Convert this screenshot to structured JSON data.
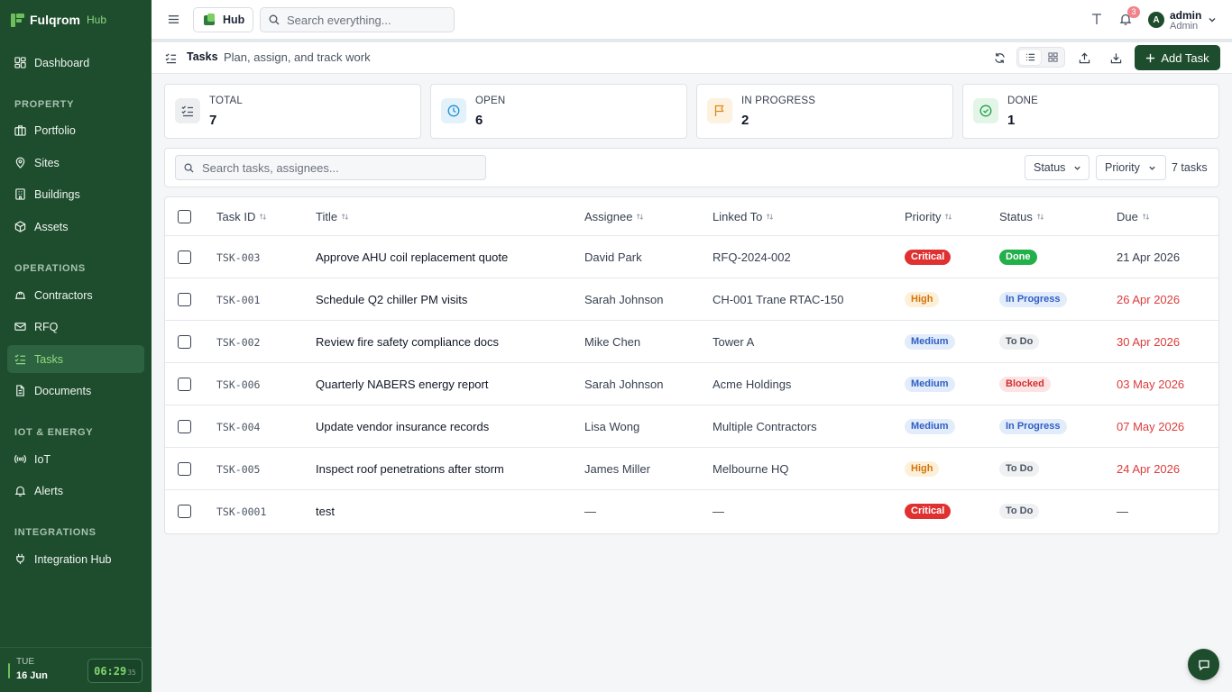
{
  "brand": {
    "name": "Fulqrom",
    "suffix": "Hub"
  },
  "sidebar": {
    "top_item": {
      "label": "Dashboard",
      "icon": "dashboard-icon"
    },
    "sections": [
      {
        "heading": "PROPERTY",
        "items": [
          {
            "label": "Portfolio",
            "icon": "briefcase-icon"
          },
          {
            "label": "Sites",
            "icon": "map-pin-icon"
          },
          {
            "label": "Buildings",
            "icon": "building-icon"
          },
          {
            "label": "Assets",
            "icon": "cube-icon"
          }
        ]
      },
      {
        "heading": "OPERATIONS",
        "items": [
          {
            "label": "Contractors",
            "icon": "hard-hat-icon"
          },
          {
            "label": "RFQ",
            "icon": "envelope-icon"
          },
          {
            "label": "Tasks",
            "icon": "list-checks-icon",
            "active": true
          },
          {
            "label": "Documents",
            "icon": "document-icon"
          }
        ]
      },
      {
        "heading": "IOT & ENERGY",
        "items": [
          {
            "label": "IoT",
            "icon": "radio-icon"
          },
          {
            "label": "Alerts",
            "icon": "bell-icon"
          }
        ]
      },
      {
        "heading": "INTEGRATIONS",
        "items": [
          {
            "label": "Integration Hub",
            "icon": "plug-icon"
          }
        ]
      }
    ],
    "footer": {
      "day": "TUE",
      "date": "16 Jun",
      "time": "06:29",
      "seconds": "35"
    }
  },
  "topbar": {
    "hub_label": "Hub",
    "search_placeholder": "Search everything...",
    "notification_count": "3",
    "user": {
      "initial": "A",
      "name": "admin",
      "role": "Admin"
    }
  },
  "page": {
    "title": "Tasks",
    "subtitle": "Plan, assign, and track work",
    "add_button": "Add Task"
  },
  "stats": [
    {
      "label": "TOTAL",
      "value": "7",
      "icon": "list-checks-icon",
      "color": "#4b5563",
      "bg": "#eceef0"
    },
    {
      "label": "OPEN",
      "value": "6",
      "icon": "clock-icon",
      "color": "#1f8fd8",
      "bg": "#e3f1fb"
    },
    {
      "label": "IN PROGRESS",
      "value": "2",
      "icon": "flag-icon",
      "color": "#e08a13",
      "bg": "#fdf1df"
    },
    {
      "label": "DONE",
      "value": "1",
      "icon": "check-circle-icon",
      "color": "#22a04a",
      "bg": "#e2f5e7"
    }
  ],
  "filters": {
    "search_placeholder": "Search tasks, assignees...",
    "status_label": "Status",
    "priority_label": "Priority",
    "count_text": "7 tasks"
  },
  "table": {
    "columns": [
      "Task ID",
      "Title",
      "Assignee",
      "Linked To",
      "Priority",
      "Status",
      "Due"
    ],
    "rows": [
      {
        "id": "TSK-003",
        "title": "Approve AHU coil replacement quote",
        "assignee": "David Park",
        "linked": "RFQ-2024-002",
        "priority": "Critical",
        "status": "Done",
        "due": "21 Apr 2026",
        "overdue": false
      },
      {
        "id": "TSK-001",
        "title": "Schedule Q2 chiller PM visits",
        "assignee": "Sarah Johnson",
        "linked": "CH-001 Trane RTAC-150",
        "priority": "High",
        "status": "In Progress",
        "due": "26 Apr 2026",
        "overdue": true
      },
      {
        "id": "TSK-002",
        "title": "Review fire safety compliance docs",
        "assignee": "Mike Chen",
        "linked": "Tower A",
        "priority": "Medium",
        "status": "To Do",
        "due": "30 Apr 2026",
        "overdue": true
      },
      {
        "id": "TSK-006",
        "title": "Quarterly NABERS energy report",
        "assignee": "Sarah Johnson",
        "linked": "Acme Holdings",
        "priority": "Medium",
        "status": "Blocked",
        "due": "03 May 2026",
        "overdue": true
      },
      {
        "id": "TSK-004",
        "title": "Update vendor insurance records",
        "assignee": "Lisa Wong",
        "linked": "Multiple Contractors",
        "priority": "Medium",
        "status": "In Progress",
        "due": "07 May 2026",
        "overdue": true
      },
      {
        "id": "TSK-005",
        "title": "Inspect roof penetrations after storm",
        "assignee": "James Miller",
        "linked": "Melbourne HQ",
        "priority": "High",
        "status": "To Do",
        "due": "24 Apr 2026",
        "overdue": true
      },
      {
        "id": "TSK-0001",
        "title": "test",
        "assignee": "—",
        "linked": "—",
        "priority": "Critical",
        "status": "To Do",
        "due": "—",
        "overdue": false
      }
    ]
  },
  "colors": {
    "sidebar_bg": "#1e4d2e",
    "accent": "#6cc05b",
    "overdue": "#dc3c3c"
  }
}
